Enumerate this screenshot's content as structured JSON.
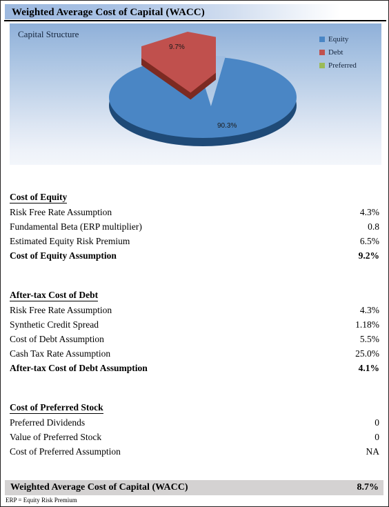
{
  "document": {
    "title": "Weighted Average Cost of Capital (WACC)",
    "footnote": "ERP = Equity Risk Premium"
  },
  "chart_data": {
    "type": "pie",
    "title": "Capital Structure",
    "categories": [
      "Equity",
      "Debt",
      "Preferred"
    ],
    "values": [
      90.3,
      9.7,
      0
    ],
    "data_labels": [
      "90.3%",
      "9.7%",
      ""
    ],
    "colors": [
      "#4a86c5",
      "#c0504d",
      "#9bbb59"
    ],
    "side_colors": [
      "#1f4a77",
      "#7c2a22",
      "#6c8a3a"
    ],
    "exploded": [
      "Debt"
    ],
    "legend": {
      "position": "right",
      "entries": [
        {
          "label": "Equity",
          "color": "#4a86c5"
        },
        {
          "label": "Debt",
          "color": "#c0504d"
        },
        {
          "label": "Preferred",
          "color": "#9bbb59"
        }
      ]
    },
    "three_d": true,
    "xlabel": "",
    "ylabel": ""
  },
  "sections": [
    {
      "heading": "Cost of Equity",
      "rows": [
        {
          "label": "Risk Free Rate Assumption",
          "value": "4.3%",
          "bold": false
        },
        {
          "label": "Fundamental Beta (ERP multiplier)",
          "value": "0.8",
          "bold": false
        },
        {
          "label": "Estimated Equity Risk Premium",
          "value": "6.5%",
          "bold": false
        },
        {
          "label": "Cost of Equity Assumption",
          "value": "9.2%",
          "bold": true
        }
      ]
    },
    {
      "heading": "After-tax Cost of Debt",
      "rows": [
        {
          "label": "Risk Free Rate Assumption",
          "value": "4.3%",
          "bold": false
        },
        {
          "label": "Synthetic Credit Spread",
          "value": "1.18%",
          "bold": false
        },
        {
          "label": "Cost of Debt Assumption",
          "value": "5.5%",
          "bold": false
        },
        {
          "label": "Cash Tax Rate Assumption",
          "value": "25.0%",
          "bold": false
        },
        {
          "label": "After-tax Cost of Debt Assumption",
          "value": "4.1%",
          "bold": true
        }
      ]
    },
    {
      "heading": "Cost of Preferred Stock",
      "rows": [
        {
          "label": "Preferred Dividends",
          "value": "0",
          "bold": false
        },
        {
          "label": "Value of Preferred Stock",
          "value": "0",
          "bold": false
        },
        {
          "label": "Cost of Preferred Assumption",
          "value": "NA",
          "bold": false
        }
      ]
    }
  ],
  "footer": {
    "label": "Weighted Average Cost of Capital (WACC)",
    "value": "8.7%"
  }
}
